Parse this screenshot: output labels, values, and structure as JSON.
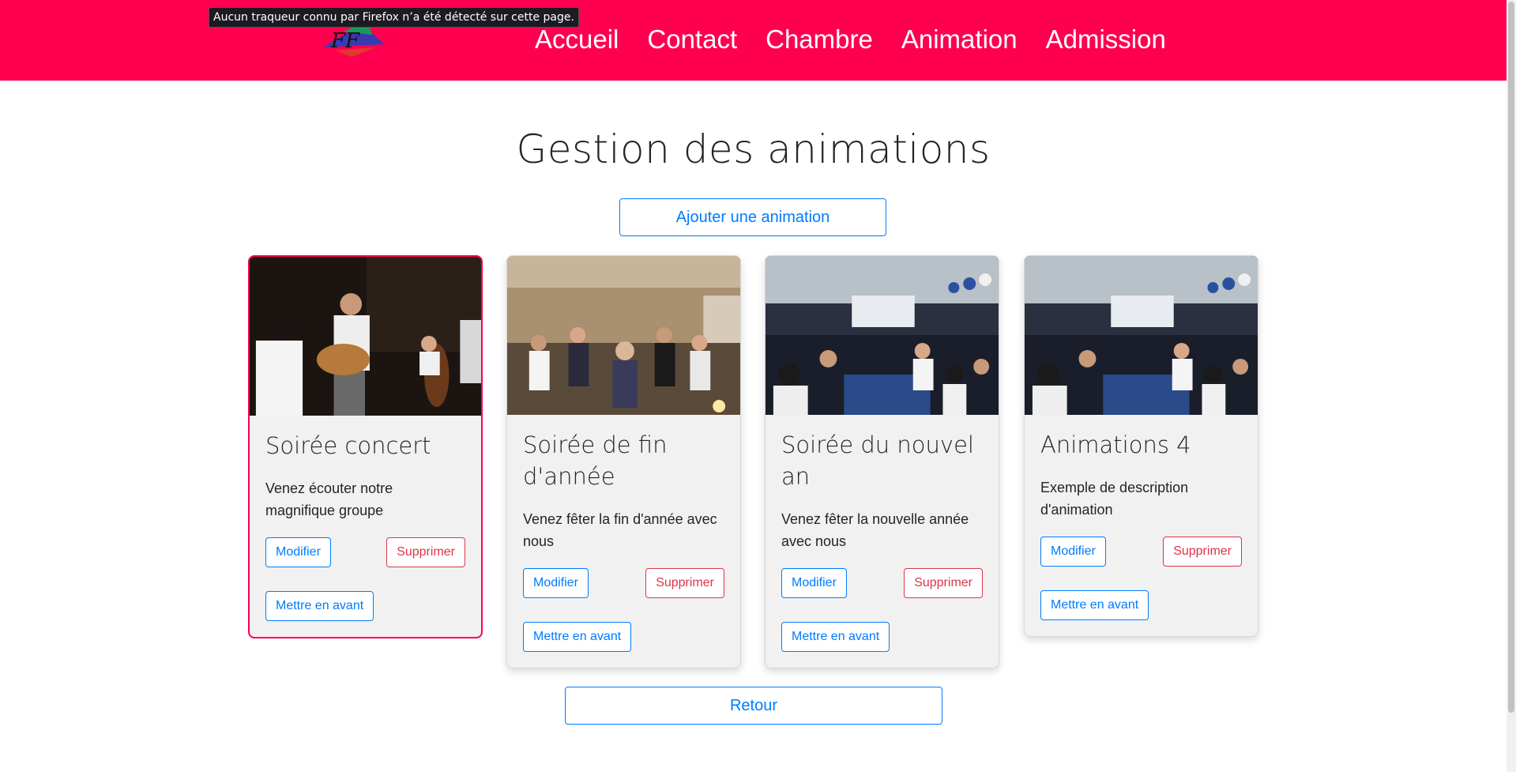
{
  "tooltip": {
    "text": "Aucun traqueur connu par Firefox n’a été détecté sur cette page."
  },
  "nav": {
    "links": [
      "Accueil",
      "Contact",
      "Chambre",
      "Animation",
      "Admission"
    ]
  },
  "colors": {
    "brand": "#ff0050",
    "primary": "#007bff",
    "danger": "#dc3545"
  },
  "page": {
    "title": "Gestion des animations",
    "add_label": "Ajouter une animation",
    "back_label": "Retour"
  },
  "cards": [
    {
      "title": "Soirée concert",
      "text": "Venez écouter notre magnifique groupe",
      "edit": "Modifier",
      "delete": "Supprimer",
      "feature": "Mettre en avant"
    },
    {
      "title": "Soirée de fin d'année",
      "text": "Venez fêter la fin d'année avec nous",
      "edit": "Modifier",
      "delete": "Supprimer",
      "feature": "Mettre en avant"
    },
    {
      "title": "Soirée du nouvel an",
      "text": "Venez fêter la nouvelle année avec nous",
      "edit": "Modifier",
      "delete": "Supprimer",
      "feature": "Mettre en avant"
    },
    {
      "title": "Animations 4",
      "text": "Exemple de description d'animation",
      "edit": "Modifier",
      "delete": "Supprimer",
      "feature": "Mettre en avant"
    }
  ]
}
